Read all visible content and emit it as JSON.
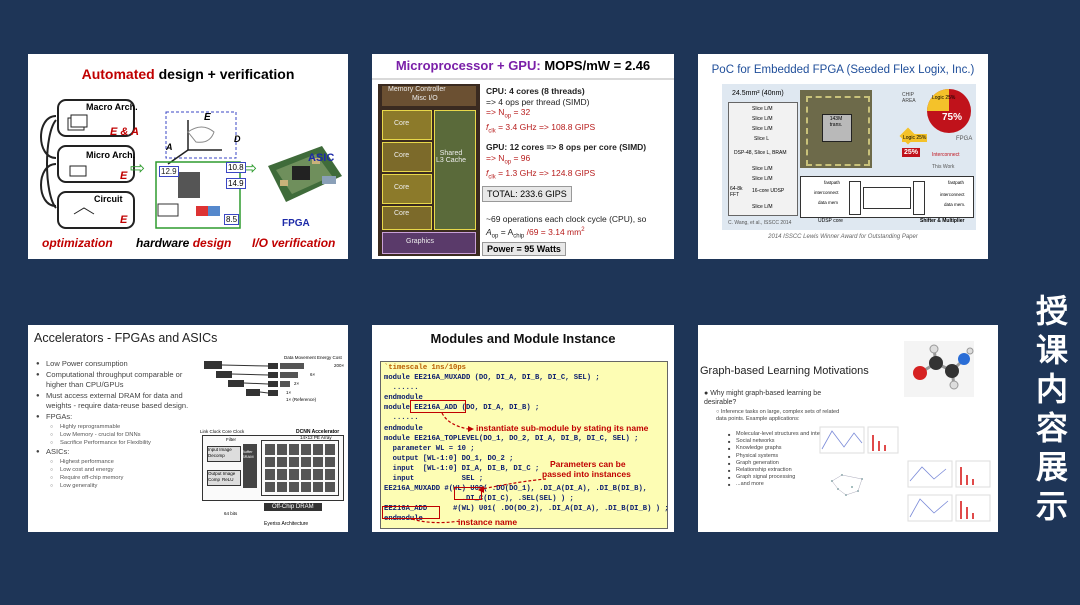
{
  "side_title": [
    "授",
    "课",
    "内",
    "容",
    "展",
    "示"
  ],
  "slide1": {
    "title_a": "Automated",
    "title_b": " design + verification",
    "boxes": [
      "Macro Arch.",
      "E & A",
      "Micro Arch.",
      "E",
      "Circuit",
      "E"
    ],
    "hw_labels": [
      "E",
      "A",
      "D",
      "12.9",
      "10.8",
      "14.9",
      "8.5"
    ],
    "asic": "ASIC",
    "fpga": "FPGA",
    "caption_optimization": "optimization",
    "caption_hardware": "hardware",
    "caption_design": " design",
    "caption_io": "I/O verification"
  },
  "slide2": {
    "title_a": "Microprocessor + GPU:",
    "title_b": " MOPS/mW = 2.46",
    "die_labels": [
      "Memory Controller",
      "Misc I/O",
      "Core",
      "Core",
      "Core",
      "Core",
      "Shared L3 Cache",
      "Graphics"
    ],
    "cpu1": "CPU: 4 cores (8 threads)",
    "cpu2": "=> 4 ops per thread (SIMD)",
    "cpu3": "=> N",
    "cpu3_sub": "op",
    "cpu3_val": " = 32",
    "cpu4": "f",
    "cpu4_sub": "clk",
    "cpu4_val": " = 3.4 GHz => 108.8 GIPS",
    "gpu1": "GPU: 12 cores => 8 ops per core (SIMD)",
    "gpu2": "=> N",
    "gpu2_sub": "op",
    "gpu2_val": " = 96",
    "gpu3": "f",
    "gpu3_sub": "clk",
    "gpu3_val": " = 1.3 GHz => 124.8 GIPS",
    "total": "TOTAL: 233.6 GIPS",
    "ops1": "~69 operations each clock cycle (CPU), so",
    "ops2a": "A",
    "ops2a_sub": "op",
    "ops2b": " = A",
    "ops2b_sub": "chip",
    "ops2c": " /69 = 3.14 mm",
    "ops2_sup": "2",
    "power": "Power = 95 Watts"
  },
  "slide3": {
    "title": "PoC for Embedded FPGA (Seeded Flex Logix, Inc.)",
    "area": "24.5mm² (40nm)",
    "slices": [
      "Slice L/M",
      "Slice L/M",
      "Slice L/M",
      "Slice L",
      "DSP-48, Slice L, BRAM",
      "Slice L/M",
      "Slice L/M",
      "16-core UDSP",
      "Slice L/M"
    ],
    "fft": "64-8k FFT",
    "credit": "C. Wang, et al., ISSCC 2014",
    "chip_center": "143M trans.",
    "chip_area": "CHIP AREA",
    "logic_pie": "Logic 25%",
    "pct75": "75%",
    "fpga_lbl": "FPGA",
    "logic2": "Logic 25%",
    "pct25": "25%",
    "interconnect": "Interconnect",
    "this_work": "This Work",
    "udsp": "UDSP core",
    "fastpath1": "fastpath",
    "interconnect1": "interconnect",
    "datamem1": "data mem",
    "fastpath2": "fastpath",
    "interconnect2": "interconnect",
    "datamem2": "data mem.",
    "shifter": "Shifter & Multiplier",
    "award": "2014 ISSCC Lewis Winner Award for Outstanding Paper"
  },
  "slide4": {
    "title": "Accelerators - FPGAs and ASICs",
    "bullets": [
      {
        "text": "Low Power consumption",
        "level": 1
      },
      {
        "text": "Computational throughput comparable or higher than CPU/GPUs",
        "level": 1
      },
      {
        "text": "Must access external DRAM for data and weights - require data-reuse based design.",
        "level": 1
      },
      {
        "text": "FPGAs:",
        "level": 1
      },
      {
        "text": "Highly reprogrammable",
        "level": 2
      },
      {
        "text": "Low Memory - crucial for DNNs",
        "level": 2
      },
      {
        "text": "Sacrifice Performance for Flexibility",
        "level": 2
      },
      {
        "text": "ASICs:",
        "level": 1
      },
      {
        "text": "Highest performance",
        "level": 2
      },
      {
        "text": "Low cost and energy",
        "level": 2
      },
      {
        "text": "Require off-chip memory",
        "level": 2
      },
      {
        "text": "Low generality",
        "level": 2
      }
    ],
    "energy_title": "Data Movement Energy Cost",
    "energy_values": [
      "200×",
      "6×",
      "2×",
      "1×",
      "1× (Reference)"
    ],
    "clock_label": "Link Clock   Core Clock",
    "dcnn": "DCNN Accelerator",
    "pe_array": "14×12 PE Array",
    "filter": "Filter",
    "input_image": "Input Image",
    "decomp": "Decomp",
    "buffer": "Buffer SRAM",
    "output_image": "Output Image",
    "comp": "Comp",
    "relu": "ReLU",
    "offchip": "Off-Chip DRAM",
    "bits": "64 bits",
    "eyeriss": "Eyeriss Architecture"
  },
  "slide5": {
    "title": "Modules and Module Instance",
    "lines": [
      "`timescale 1ns/10ps",
      "module EE216A_MUXADD (DO, DI_A, DI_B, DI_C, SEL) ;",
      "  ......",
      "endmodule",
      "module EE216A_ADD (DO, DI_A, DI_B) ;",
      "  ......",
      "endmodule",
      "module EE216A_TOPLEVEL(DO_1, DO_2, DI_A, DI_B, DI_C, SEL) ;",
      "  parameter WL = 10 ;",
      "  output [WL-1:0] DO_1, DO_2 ;",
      "  input  [WL-1:0] DI_A, DI_B, DI_C ;",
      "  input           SEL ;",
      "EE216A_MUXADD #(WL) U00( .DO(DO_1), .DI_A(DI_A), .DI_B(DI_B),",
      "                  .DI_C(DI_C), .SEL(SEL) ) ;",
      "EE216A_ADD      #(WL) U01( .DO(DO_2), .DI_A(DI_A), .DI_B(DI_B) ) ;",
      "endmodule"
    ],
    "note_instantiate": "instantiate sub-module by stating its name",
    "note_params1": "Parameters can be",
    "note_params2": "passed into instances",
    "note_instance": "instance name"
  },
  "slide6": {
    "title": "Graph-based Learning Motivations",
    "q1": "Why might graph-based learning be desirable?",
    "q2": "Inference tasks on large, complex sets of related data points. Example applications:",
    "apps": [
      "Molecular-level structures and interactions",
      "Social networks",
      "Knowledge graphs",
      "Physical systems",
      "Graph generation",
      "Relationship extraction",
      "Graph signal processing",
      "...and more"
    ]
  }
}
